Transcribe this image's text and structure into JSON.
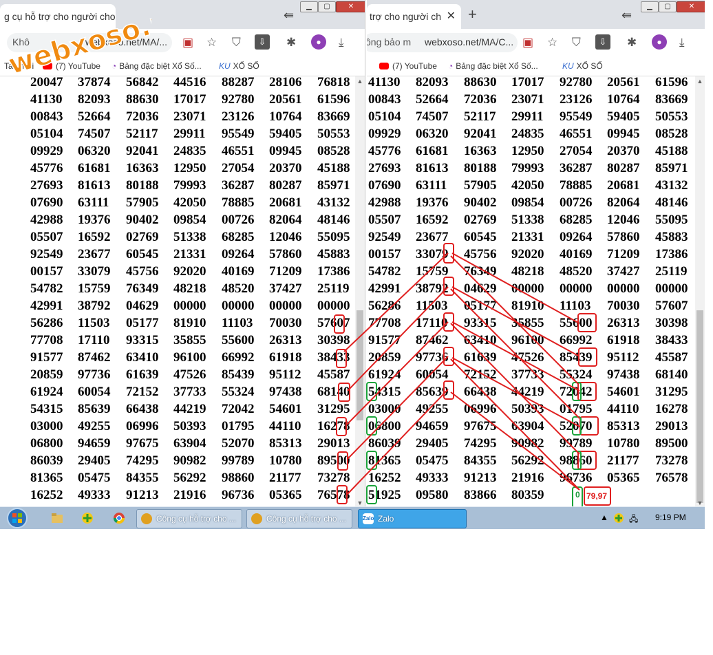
{
  "watermark_text": "webxoso.net",
  "left_window": {
    "tab_title": "g cụ hỗ trợ cho người cho",
    "security_label": "Khô",
    "url": "webxoso.net/MA/...",
    "bookmarks": [
      "Tab mới",
      "(7) YouTube",
      "Bảng đặc biệt Xổ Số...",
      "XỔ SỐ"
    ],
    "rows": [
      [
        "20047",
        "37874",
        "56842",
        "44516",
        "88287",
        "28106",
        "76818"
      ],
      [
        "41130",
        "82093",
        "88630",
        "17017",
        "92780",
        "20561",
        "61596"
      ],
      [
        "00843",
        "52664",
        "72036",
        "23071",
        "23126",
        "10764",
        "83669"
      ],
      [
        "05104",
        "74507",
        "52117",
        "29911",
        "95549",
        "59405",
        "50553"
      ],
      [
        "09929",
        "06320",
        "92041",
        "24835",
        "46551",
        "09945",
        "08528"
      ],
      [
        "45776",
        "61681",
        "16363",
        "12950",
        "27054",
        "20370",
        "45188"
      ],
      [
        "27693",
        "81613",
        "80188",
        "79993",
        "36287",
        "80287",
        "85971"
      ],
      [
        "07690",
        "63111",
        "57905",
        "42050",
        "78885",
        "20681",
        "43132"
      ],
      [
        "42988",
        "19376",
        "90402",
        "09854",
        "00726",
        "82064",
        "48146"
      ],
      [
        "05507",
        "16592",
        "02769",
        "51338",
        "68285",
        "12046",
        "55095"
      ],
      [
        "92549",
        "23677",
        "60545",
        "21331",
        "09264",
        "57860",
        "45883"
      ],
      [
        "00157",
        "33079",
        "45756",
        "92020",
        "40169",
        "71209",
        "17386"
      ],
      [
        "54782",
        "15759",
        "76349",
        "48218",
        "48520",
        "37427",
        "25119"
      ],
      [
        "42991",
        "38792",
        "04629",
        "00000",
        "00000",
        "00000",
        "00000"
      ],
      [
        "56286",
        "11503",
        "05177",
        "81910",
        "11103",
        "70030",
        "57607"
      ],
      [
        "77708",
        "17110",
        "93315",
        "35855",
        "55600",
        "26313",
        "30398"
      ],
      [
        "91577",
        "87462",
        "63410",
        "96100",
        "66992",
        "61918",
        "38433"
      ],
      [
        "20859",
        "97736",
        "61639",
        "47526",
        "85439",
        "95112",
        "45587"
      ],
      [
        "61924",
        "60054",
        "72152",
        "37733",
        "55324",
        "97438",
        "68140"
      ],
      [
        "54315",
        "85639",
        "66438",
        "44219",
        "72042",
        "54601",
        "31295"
      ],
      [
        "03000",
        "49255",
        "06996",
        "50393",
        "01795",
        "44110",
        "16278"
      ],
      [
        "06800",
        "94659",
        "97675",
        "63904",
        "52070",
        "85313",
        "29013"
      ],
      [
        "86039",
        "29405",
        "74295",
        "90982",
        "99789",
        "10780",
        "89500"
      ],
      [
        "81365",
        "05475",
        "84355",
        "56292",
        "98860",
        "21177",
        "73278"
      ],
      [
        "16252",
        "49333",
        "91213",
        "21916",
        "96736",
        "05365",
        "76578"
      ]
    ]
  },
  "right_window": {
    "tab_title": "trợ cho người ch",
    "security_label": "ông bảo m",
    "url": "webxoso.net/MA/C...",
    "bookmarks": [
      "(7) YouTube",
      "Bảng đặc biệt Xổ Số...",
      "XỔ SỐ"
    ],
    "rows": [
      [
        "41130",
        "82093",
        "88630",
        "17017",
        "92780",
        "20561",
        "61596"
      ],
      [
        "00843",
        "52664",
        "72036",
        "23071",
        "23126",
        "10764",
        "83669"
      ],
      [
        "05104",
        "74507",
        "52117",
        "29911",
        "95549",
        "59405",
        "50553"
      ],
      [
        "09929",
        "06320",
        "92041",
        "24835",
        "46551",
        "09945",
        "08528"
      ],
      [
        "45776",
        "61681",
        "16363",
        "12950",
        "27054",
        "20370",
        "45188"
      ],
      [
        "27693",
        "81613",
        "80188",
        "79993",
        "36287",
        "80287",
        "85971"
      ],
      [
        "07690",
        "63111",
        "57905",
        "42050",
        "78885",
        "20681",
        "43132"
      ],
      [
        "42988",
        "19376",
        "90402",
        "09854",
        "00726",
        "82064",
        "48146"
      ],
      [
        "05507",
        "16592",
        "02769",
        "51338",
        "68285",
        "12046",
        "55095"
      ],
      [
        "92549",
        "23677",
        "60545",
        "21331",
        "09264",
        "57860",
        "45883"
      ],
      [
        "00157",
        "33079",
        "45756",
        "92020",
        "40169",
        "71209",
        "17386"
      ],
      [
        "54782",
        "15759",
        "76349",
        "48218",
        "48520",
        "37427",
        "25119"
      ],
      [
        "42991",
        "38792",
        "04629",
        "00000",
        "00000",
        "00000",
        "00000"
      ],
      [
        "56286",
        "11503",
        "05177",
        "81910",
        "11103",
        "70030",
        "57607"
      ],
      [
        "77708",
        "17110",
        "93315",
        "35855",
        "55600",
        "26313",
        "30398"
      ],
      [
        "91577",
        "87462",
        "63410",
        "96100",
        "66992",
        "61918",
        "38433"
      ],
      [
        "20859",
        "97736",
        "61639",
        "47526",
        "85439",
        "95112",
        "45587"
      ],
      [
        "61924",
        "60054",
        "72152",
        "37733",
        "55324",
        "97438",
        "68140"
      ],
      [
        "54315",
        "85639",
        "66438",
        "44219",
        "72042",
        "54601",
        "31295"
      ],
      [
        "03000",
        "49255",
        "06996",
        "50393",
        "01795",
        "44110",
        "16278"
      ],
      [
        "06800",
        "94659",
        "97675",
        "63904",
        "52070",
        "85313",
        "29013"
      ],
      [
        "86039",
        "29405",
        "74295",
        "90982",
        "99789",
        "10780",
        "89500"
      ],
      [
        "81365",
        "05475",
        "84355",
        "56292",
        "98860",
        "21177",
        "73278"
      ],
      [
        "16252",
        "49333",
        "91213",
        "21916",
        "96736",
        "05365",
        "76578"
      ],
      [
        "51925",
        "09580",
        "83866",
        "80359",
        "",
        "",
        ""
      ]
    ],
    "annotation_zero": "0",
    "annotation_prediction": "79,97"
  },
  "taskbar": {
    "items": [
      "Công cụ hỗ trợ cho ...",
      "Công cụ hỗ trợ cho ...",
      "Zalo"
    ],
    "zalo_icon_text": "Zalo",
    "clock": "9:19 PM"
  },
  "colors": {
    "highlight_red": "#e02020",
    "highlight_green": "#1aa33a",
    "watermark": "#f08a10"
  }
}
